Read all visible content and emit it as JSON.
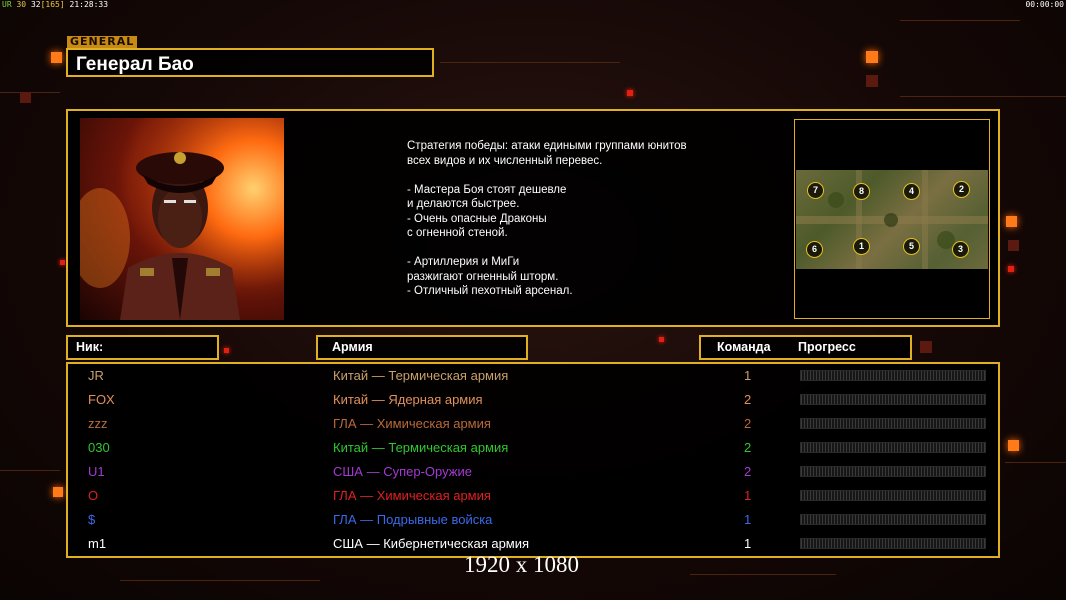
{
  "hud": {
    "left_prefix": "UR",
    "left_a": "30",
    "left_b": "32",
    "left_c": "[165]",
    "clock": "21:28:33",
    "right_clock": "00:00:00"
  },
  "general": {
    "tag": "GENERAL",
    "name": "Генерал Бао",
    "strategy": "Стратегия победы: атаки едиными группами юнитов всех видов и их численный перевес.\n\n- Мастера Боя стоят дешевле\nи делаются быстрее.\n- Очень опасные Драконы\nс огненной стеной.\n\n- Артиллерия и МиГи\nразжигают огненный шторм.\n- Отличный пехотный арсенал."
  },
  "map": {
    "slots": [
      "7",
      "8",
      "4",
      "2",
      "6",
      "1",
      "5",
      "3"
    ]
  },
  "table": {
    "headers": {
      "nick": "Ник:",
      "army": "Армия",
      "team": "Команда",
      "progress": "Прогресс"
    },
    "rows": [
      {
        "nick": "JR",
        "army": "Китай — Термическая армия",
        "team": "1",
        "color": "#c8a06a"
      },
      {
        "nick": "FOX",
        "army": "Китай — Ядерная армия",
        "team": "2",
        "color": "#e0915a"
      },
      {
        "nick": "zzz",
        "army": "ГЛА — Химическая армия",
        "team": "2",
        "color": "#b86a3a"
      },
      {
        "nick": "030",
        "army": "Китай — Термическая армия",
        "team": "2",
        "color": "#2ec82e"
      },
      {
        "nick": "U1",
        "army": "США — Супер-Оружие",
        "team": "2",
        "color": "#a43ad2"
      },
      {
        "nick": "O",
        "army": "ГЛА — Химическая армия",
        "team": "1",
        "color": "#e02020"
      },
      {
        "nick": "$",
        "army": "ГЛА — Подрывные войска",
        "team": "1",
        "color": "#3a6ae8"
      },
      {
        "nick": "m1",
        "army": "США — Кибернетическая армия",
        "team": "1",
        "color": "#ffffff"
      }
    ]
  },
  "resolution": "1920 x 1080",
  "colors": {
    "accent": "#e0b020",
    "deco": "#ff7a18"
  }
}
